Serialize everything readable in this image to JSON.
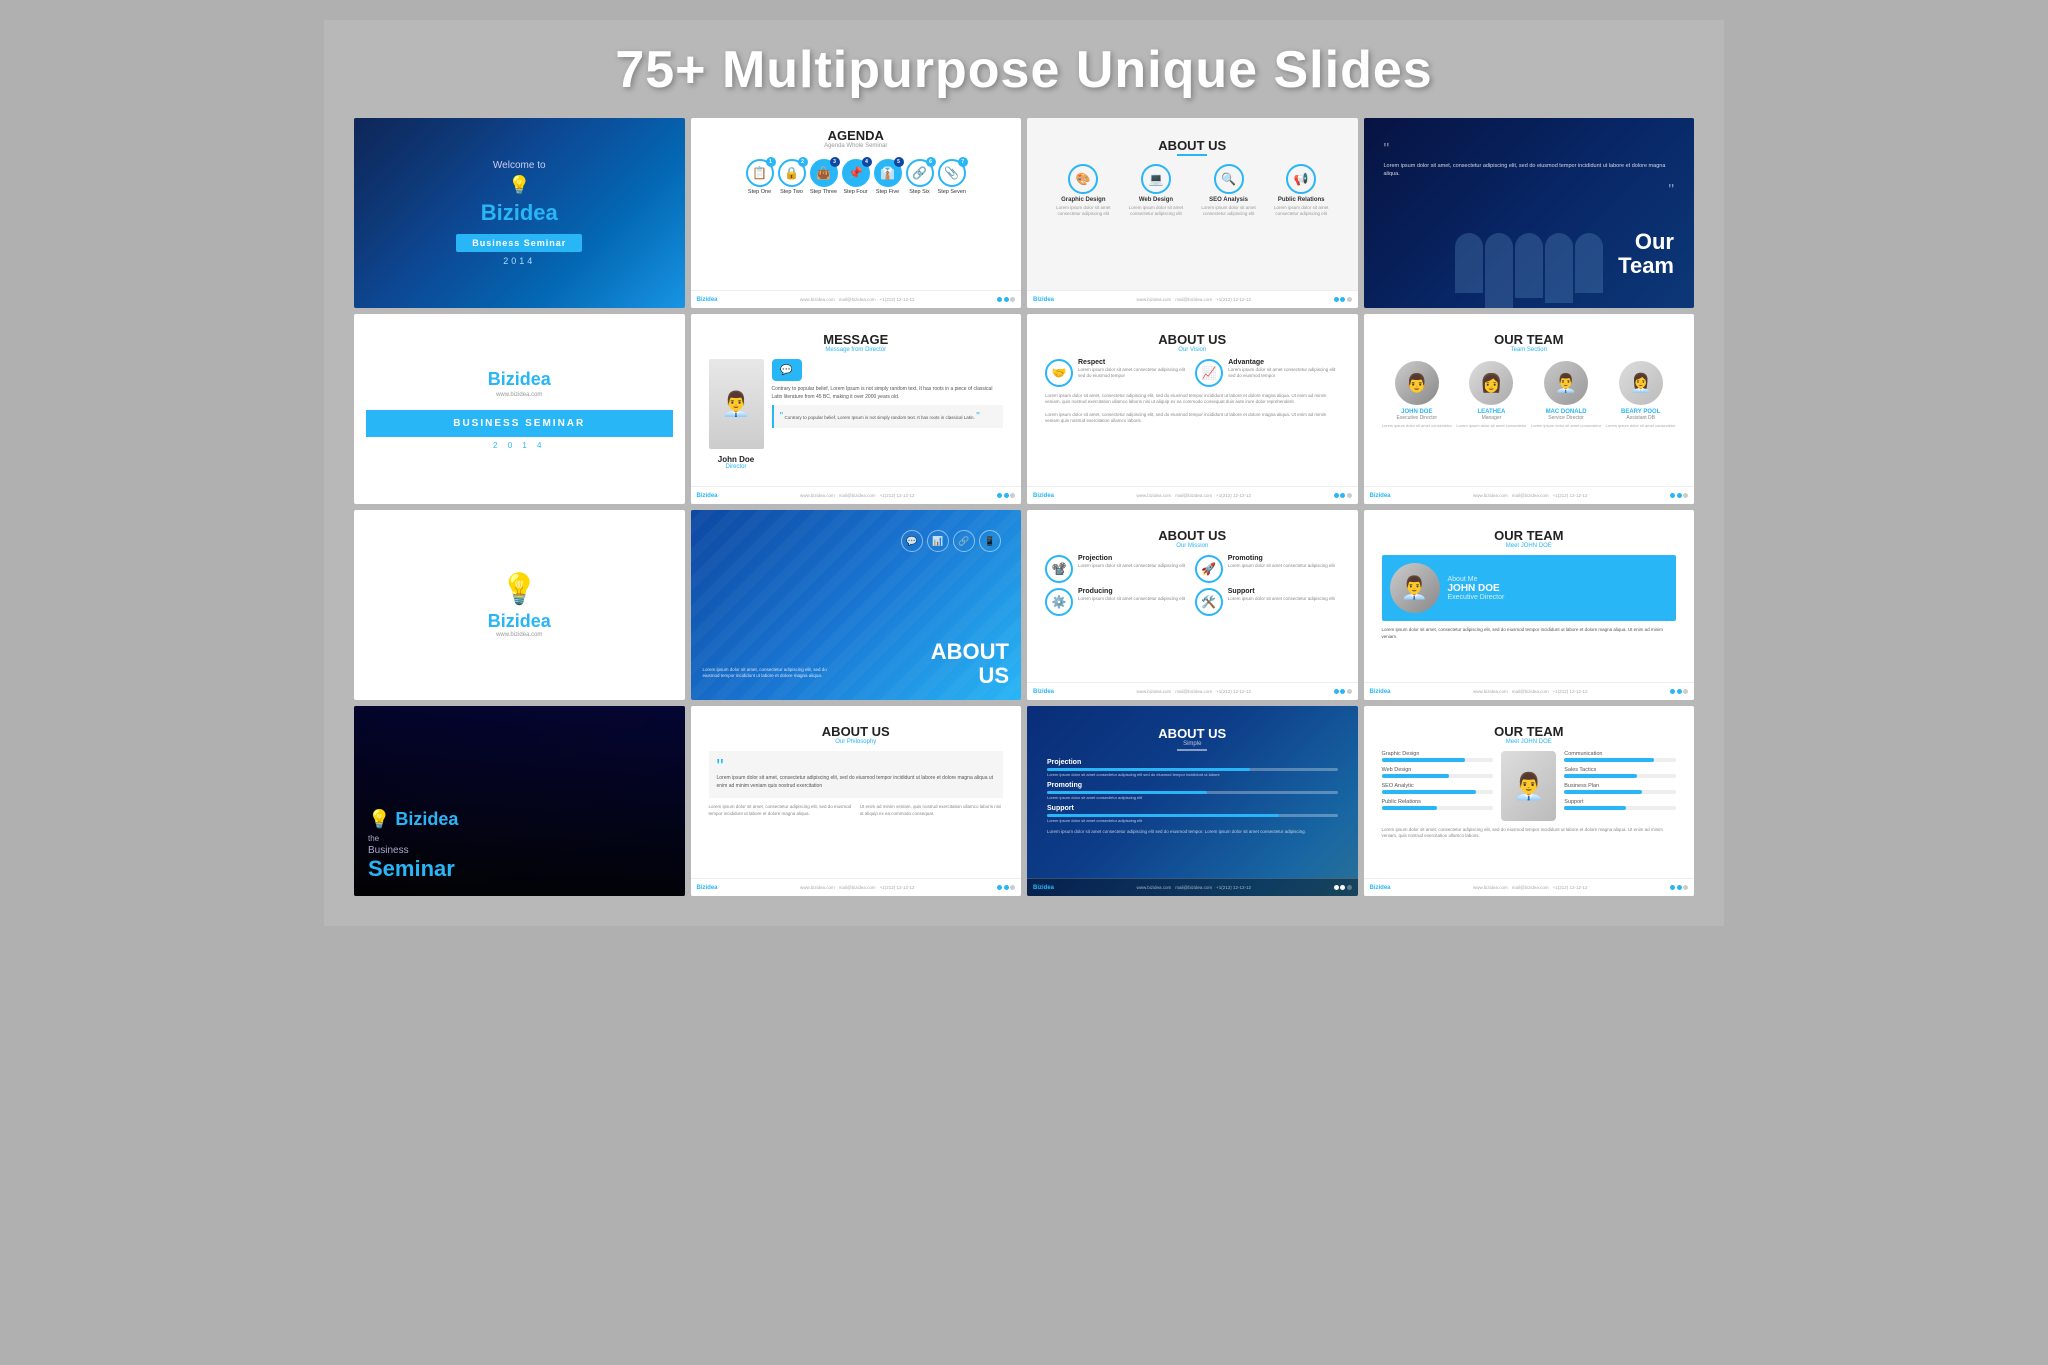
{
  "page": {
    "title": "75+ Multipurpose Unique Slides",
    "background": "#b0b0b0"
  },
  "slides": [
    {
      "id": 1,
      "type": "welcome",
      "welcome": "Welcome to",
      "brand": "Biz",
      "brand2": "idea",
      "tagline": "Business Seminar",
      "year": "2014"
    },
    {
      "id": 2,
      "type": "agenda",
      "title": "AGENDA",
      "subtitle": "Agenda Whole Seminar",
      "steps": [
        {
          "num": "1",
          "label": "Step One",
          "icon": "📋"
        },
        {
          "num": "2",
          "label": "Step Two",
          "icon": "🔒"
        },
        {
          "num": "3",
          "label": "Step Three",
          "icon": "👜"
        },
        {
          "num": "4",
          "label": "Step Four",
          "icon": "📌"
        },
        {
          "num": "5",
          "label": "Step Five",
          "icon": "👔"
        },
        {
          "num": "6",
          "label": "Step Six",
          "icon": "🔗"
        },
        {
          "num": "7",
          "label": "Step Seven",
          "icon": "📎"
        }
      ]
    },
    {
      "id": 3,
      "type": "about-us",
      "title": "ABOUT US",
      "services": [
        {
          "label": "Graphic Design",
          "icon": "🎨"
        },
        {
          "label": "Web Design",
          "icon": "💻"
        },
        {
          "label": "SEO Analysis",
          "icon": "🔍"
        },
        {
          "label": "Public Relations",
          "icon": "📢"
        }
      ]
    },
    {
      "id": 4,
      "type": "our-team-photo",
      "title": "Our",
      "title2": "Team",
      "quote": "Lorem ipsum dolor sit amet, consectetur adipiscing elit, sed do eiusmod tempor incididunt"
    },
    {
      "id": 5,
      "type": "biz-seminar",
      "brand": "Biz",
      "brand2": "idea",
      "website": "www.bizidea.com",
      "label": "BUSINESS SEMINAR",
      "year": "2 0 1 4"
    },
    {
      "id": 6,
      "type": "message",
      "title": "MESSAGE",
      "subtitle": "Message from Director",
      "body": "Contrary to popular belief, Lorem Ipsum is not simply random text. It has roots in a piece of classical Latin literature from 45 BC, making it over 2000 years old.",
      "person_name": "John Doe",
      "person_role": "Director",
      "company": "Bizidea",
      "quote": "Contrary to popular belief, Lorem Ipsum is not simply random text. It has roots in classical Latin."
    },
    {
      "id": 7,
      "type": "about-us-features",
      "title": "ABOUT US",
      "subtitle": "Our Vision",
      "features": [
        {
          "title": "Respect",
          "icon": "🤝"
        },
        {
          "title": "Advantage",
          "icon": "📈"
        },
        {
          "desc": "Lorem ipsum dolor sit amet consectetur adipiscing elit sed do eiusmod tempor"
        },
        {
          "desc": "Lorem ipsum dolor sit amet consectetur adipiscing elit sed do eiusmod tempor"
        }
      ]
    },
    {
      "id": 8,
      "type": "our-team-members",
      "title": "OUR TEAM",
      "subtitle": "Team Section",
      "members": [
        {
          "name": "JOHN DOE",
          "role": "Executive Director",
          "icon": "👨"
        },
        {
          "name": "LEATHEA",
          "role": "Manager",
          "icon": "👩"
        },
        {
          "name": "MAC DONALD",
          "role": "Service Director",
          "icon": "👨‍💼"
        },
        {
          "name": "BEARY POOL",
          "role": "Assistant DB",
          "icon": "👩‍💼"
        }
      ]
    },
    {
      "id": 9,
      "type": "biz-logo-only",
      "brand": "Biz",
      "brand2": "idea",
      "website": "www.bizidea.com"
    },
    {
      "id": 10,
      "type": "about-us-blue",
      "title": "ABOUT",
      "title2": "US",
      "body": "Lorem ipsum dolor sit amet, consectetur adipiscing elit, sed do eiusmod tempor incididunt ut labore et dolore magna aliqua."
    },
    {
      "id": 11,
      "type": "about-us-mission",
      "title": "ABOUT US",
      "subtitle": "Our Mission",
      "items": [
        {
          "title": "Projection",
          "icon": "📽️"
        },
        {
          "title": "Promoting",
          "icon": "🚀"
        },
        {
          "title": "Producing",
          "icon": "⚙️"
        },
        {
          "title": "Support",
          "icon": "🛠️"
        }
      ]
    },
    {
      "id": 12,
      "type": "our-team-meet",
      "title": "OUR TEAM",
      "subtitle": "Meet JOHN DOE",
      "person_name": "JOHN DOE",
      "person_role": "Executive Director",
      "about_label": "About Me",
      "desc": "Lorem ipsum dolor sit amet, consectetur adipiscing elit, sed do eiusmod tempor incididunt ut labore et dolore magna aliqua. Ut enim ad minim veniam."
    },
    {
      "id": 13,
      "type": "dark-seminar",
      "the": "the",
      "business": "Business",
      "seminar": "Seminar",
      "brand": "Biz",
      "brand2": "idea"
    },
    {
      "id": 14,
      "type": "about-us-philosophy",
      "title": "ABOUT US",
      "subtitle": "Our Philosophy",
      "quote": "Lorem ipsum dolor sit amet, consectetur adipiscing elit, sed do eiusmod tempor incididunt ut labore et dolore magna aliqua ut enim ad minim veniam quis nostrud exercitation",
      "col1_title": "",
      "col1_text": "Lorem ipsum dolor sit amet, consectetur adipiscing elit, sed do eiusmod tempor incididunt ut labore et dolore magna aliqua.",
      "col2_title": "",
      "col2_text": "Ut enim ad minim veniam, quis nostrud exercitation ullamco laboris nisi ut aliquip ex ea commodo consequat."
    },
    {
      "id": 15,
      "type": "about-us-simple",
      "title": "ABOUT US",
      "subtitle": "Simple",
      "projection_title": "Projection",
      "projection_text": "Lorem ipsum dolor sit amet consectetur adipiscing elit sed do eiusmod tempor incididunt ut labore",
      "projection_pct": 70
    },
    {
      "id": 16,
      "type": "our-team-skills",
      "title": "OUR TEAM",
      "subtitle": "Meet JOHN DOE",
      "skills_left": [
        {
          "label": "Graphic Design",
          "pct": 75
        },
        {
          "label": "Web Design",
          "pct": 60
        },
        {
          "label": "SEO Analytic",
          "pct": 85
        },
        {
          "label": "Public Relations",
          "pct": 50
        }
      ],
      "skills_right": [
        {
          "label": "Communication",
          "pct": 80
        },
        {
          "label": "Sales Tactics",
          "pct": 65
        },
        {
          "label": "Business Plan",
          "pct": 70
        },
        {
          "label": "Support",
          "pct": 55
        }
      ],
      "person_icon": "👨‍💼"
    }
  ],
  "footer": {
    "logo": "Biz",
    "logo2": "idea",
    "email": "mail@bizidea.com",
    "website": "www.bizidea.com",
    "phone": "+1(212) 12-12-12"
  }
}
